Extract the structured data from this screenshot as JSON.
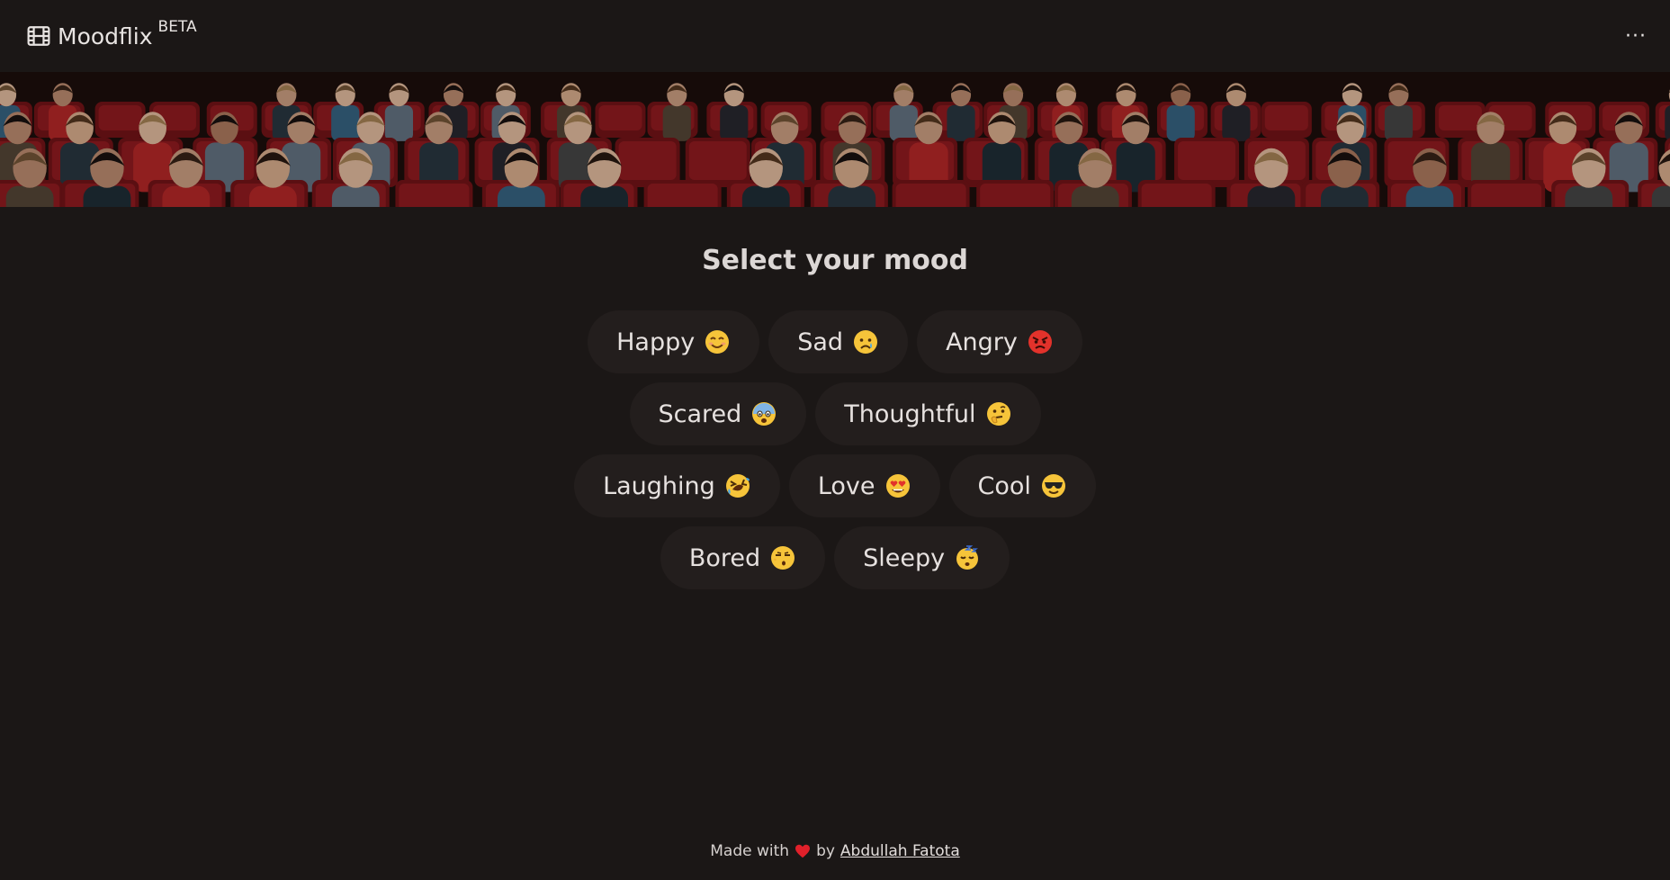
{
  "header": {
    "brand_name": "Moodflix",
    "beta_label": "BETA",
    "more_label": "···"
  },
  "hero": {
    "image": "cinema-audience-photo"
  },
  "main": {
    "title": "Select your mood",
    "rows": [
      [
        {
          "label": "Happy",
          "emoji": "smiling-face-icon"
        },
        {
          "label": "Sad",
          "emoji": "sad-face-icon"
        },
        {
          "label": "Angry",
          "emoji": "angry-face-icon"
        }
      ],
      [
        {
          "label": "Scared",
          "emoji": "fearful-face-icon"
        },
        {
          "label": "Thoughtful",
          "emoji": "thinking-face-icon"
        }
      ],
      [
        {
          "label": "Laughing",
          "emoji": "rolling-laughing-face-icon"
        },
        {
          "label": "Love",
          "emoji": "heart-eyes-face-icon"
        },
        {
          "label": "Cool",
          "emoji": "sunglasses-face-icon"
        }
      ],
      [
        {
          "label": "Bored",
          "emoji": "bored-face-icon"
        },
        {
          "label": "Sleepy",
          "emoji": "sleeping-face-icon"
        }
      ]
    ]
  },
  "footer": {
    "made_with": "Made with",
    "by": "by",
    "author": "Abdullah Fatota"
  },
  "colors": {
    "background": "#1b1716",
    "button": "#231e1d",
    "heart": "#e0202a"
  }
}
